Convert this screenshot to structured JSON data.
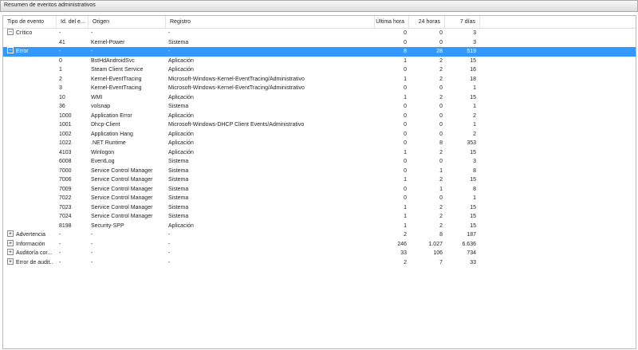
{
  "window": {
    "title": "Resumen de eventos administrativos"
  },
  "table": {
    "columns": {
      "type": "Tipo de evento",
      "id": "Id. del e...",
      "source": "Origen",
      "log": "Registro",
      "last_hour": "Última hora",
      "h24": "24 horas",
      "d7": "7 días"
    },
    "rows": [
      {
        "expander": "−",
        "type": "Crítico",
        "id": "-",
        "source": "-",
        "log": "-",
        "h1": "0",
        "h24": "0",
        "d7": "3"
      },
      {
        "type": "",
        "id": "41",
        "source": "Kernel-Power",
        "log": "Sistema",
        "h1": "0",
        "h24": "0",
        "d7": "3"
      },
      {
        "expander": "−",
        "type": "Error",
        "id": "-",
        "source": "-",
        "log": "-",
        "h1": "8",
        "h24": "28",
        "d7": "519",
        "selected": true
      },
      {
        "type": "",
        "id": "0",
        "source": "BstHdAndroidSvc",
        "log": "Aplicación",
        "h1": "1",
        "h24": "2",
        "d7": "15"
      },
      {
        "type": "",
        "id": "1",
        "source": "Steam Client Service",
        "log": "Aplicación",
        "h1": "0",
        "h24": "2",
        "d7": "16"
      },
      {
        "type": "",
        "id": "2",
        "source": "Kernel-EventTracing",
        "log": "Microsoft-Windows-Kernel-EventTracing/Administrativo",
        "h1": "1",
        "h24": "2",
        "d7": "18"
      },
      {
        "type": "",
        "id": "3",
        "source": "Kernel-EventTracing",
        "log": "Microsoft-Windows-Kernel-EventTracing/Administrativo",
        "h1": "0",
        "h24": "0",
        "d7": "1"
      },
      {
        "type": "",
        "id": "10",
        "source": "WMI",
        "log": "Aplicación",
        "h1": "1",
        "h24": "2",
        "d7": "15"
      },
      {
        "type": "",
        "id": "36",
        "source": "volsnap",
        "log": "Sistema",
        "h1": "0",
        "h24": "0",
        "d7": "1"
      },
      {
        "type": "",
        "id": "1000",
        "source": "Application Error",
        "log": "Aplicación",
        "h1": "0",
        "h24": "0",
        "d7": "2"
      },
      {
        "type": "",
        "id": "1001",
        "source": "Dhcp-Client",
        "log": "Microsoft-Windows-DHCP Client Events/Administrativo",
        "h1": "0",
        "h24": "0",
        "d7": "1"
      },
      {
        "type": "",
        "id": "1002",
        "source": "Application Hang",
        "log": "Aplicación",
        "h1": "0",
        "h24": "0",
        "d7": "2"
      },
      {
        "type": "",
        "id": "1022",
        "source": ".NET Runtime",
        "log": "Aplicación",
        "h1": "0",
        "h24": "8",
        "d7": "353"
      },
      {
        "type": "",
        "id": "4103",
        "source": "Winlogon",
        "log": "Aplicación",
        "h1": "1",
        "h24": "2",
        "d7": "15"
      },
      {
        "type": "",
        "id": "6008",
        "source": "EventLog",
        "log": "Sistema",
        "h1": "0",
        "h24": "0",
        "d7": "3"
      },
      {
        "type": "",
        "id": "7000",
        "source": "Service Control Manager",
        "log": "Sistema",
        "h1": "0",
        "h24": "1",
        "d7": "8"
      },
      {
        "type": "",
        "id": "7006",
        "source": "Service Control Manager",
        "log": "Sistema",
        "h1": "1",
        "h24": "2",
        "d7": "15"
      },
      {
        "type": "",
        "id": "7009",
        "source": "Service Control Manager",
        "log": "Sistema",
        "h1": "0",
        "h24": "1",
        "d7": "8"
      },
      {
        "type": "",
        "id": "7022",
        "source": "Service Control Manager",
        "log": "Sistema",
        "h1": "0",
        "h24": "0",
        "d7": "1"
      },
      {
        "type": "",
        "id": "7023",
        "source": "Service Control Manager",
        "log": "Sistema",
        "h1": "1",
        "h24": "2",
        "d7": "15"
      },
      {
        "type": "",
        "id": "7024",
        "source": "Service Control Manager",
        "log": "Sistema",
        "h1": "1",
        "h24": "2",
        "d7": "15"
      },
      {
        "type": "",
        "id": "8198",
        "source": "Security-SPP",
        "log": "Aplicación",
        "h1": "1",
        "h24": "2",
        "d7": "15"
      },
      {
        "expander": "+",
        "type": "Advertencia",
        "id": "-",
        "source": "-",
        "log": "-",
        "h1": "2",
        "h24": "8",
        "d7": "187"
      },
      {
        "expander": "+",
        "type": "Información",
        "id": "-",
        "source": "-",
        "log": "-",
        "h1": "246",
        "h24": "1.027",
        "d7": "6.636"
      },
      {
        "expander": "+",
        "type": "Auditoría cor...",
        "id": "-",
        "source": "-",
        "log": "-",
        "h1": "33",
        "h24": "106",
        "d7": "734"
      },
      {
        "expander": "+",
        "type": "Error de audit...",
        "id": "-",
        "source": "-",
        "log": "-",
        "h1": "2",
        "h24": "7",
        "d7": "33"
      }
    ]
  },
  "colors": {
    "selection": "#3399ff"
  }
}
